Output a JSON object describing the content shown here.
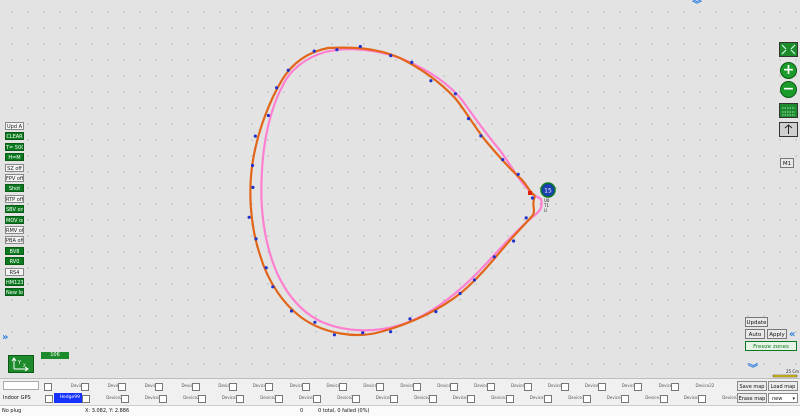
{
  "left_toolbar": [
    {
      "label": "Upd A",
      "state": "off"
    },
    {
      "label": "CLEAR",
      "state": "on"
    },
    {
      "label": "T= 500",
      "state": "on"
    },
    {
      "label": "H=M",
      "state": "on"
    },
    {
      "label": "SZ off",
      "state": "off"
    },
    {
      "label": "FPV off",
      "state": "off"
    },
    {
      "label": "Shot",
      "state": "on"
    },
    {
      "label": "RTP off",
      "state": "off"
    },
    {
      "label": "SBV on",
      "state": "on"
    },
    {
      "label": "MOV on",
      "state": "on"
    },
    {
      "label": "RMV off",
      "state": "off"
    },
    {
      "label": "PBA off",
      "state": "off"
    },
    {
      "label": "BV8",
      "state": "on"
    },
    {
      "label": "RV0",
      "state": "on"
    },
    {
      "label": "RS4",
      "state": "off"
    },
    {
      "label": "HM123",
      "state": "on"
    },
    {
      "label": "New log",
      "state": "on"
    }
  ],
  "hedgehog": {
    "id": "15",
    "label": "U0\nT1\nU",
    "color": "#1a3fb0"
  },
  "axis_widget": {
    "x": "X",
    "y": "Y",
    "value": "106"
  },
  "right_tools": {
    "m1": "M1",
    "update": "Update",
    "auto": "Auto",
    "apply": "Apply",
    "freeze": "Freeze zones",
    "scale": "25 Cm"
  },
  "colors": {
    "pink": "#ff7fd1",
    "orange": "#e1661a",
    "dots": "#2233cc",
    "green": "#1d8b2b"
  },
  "devices": {
    "row1_first": "",
    "row1": [
      "Device6",
      "Device7",
      "Device8",
      "Device9",
      "Device9",
      "Device10",
      "Device11",
      "Device12",
      "Device13",
      "Device14",
      "Device15",
      "Device16",
      "Device17",
      "Device18",
      "Device19",
      "Device20",
      "Device21",
      "Device22"
    ],
    "indoor_gps": "Indoor GPS",
    "hedgehog_selected": "Hedge99",
    "row2": [
      "Device20",
      "Device21",
      "Device22",
      "Device23",
      "Device24",
      "Device25",
      "Device26",
      "Device27",
      "Device28",
      "Device29",
      "Device30",
      "Device31",
      "Device32",
      "Device33",
      "Device34",
      "Device35",
      "Device36"
    ]
  },
  "map_buttons": {
    "save": "Save map",
    "load": "Load map",
    "erase": "Erase map",
    "new": "new"
  },
  "status": {
    "plug": "No plug",
    "coords": "X: 3.082, Y: 2.886",
    "zero": "0",
    "total": "0 total, 0 failed (0%)"
  }
}
